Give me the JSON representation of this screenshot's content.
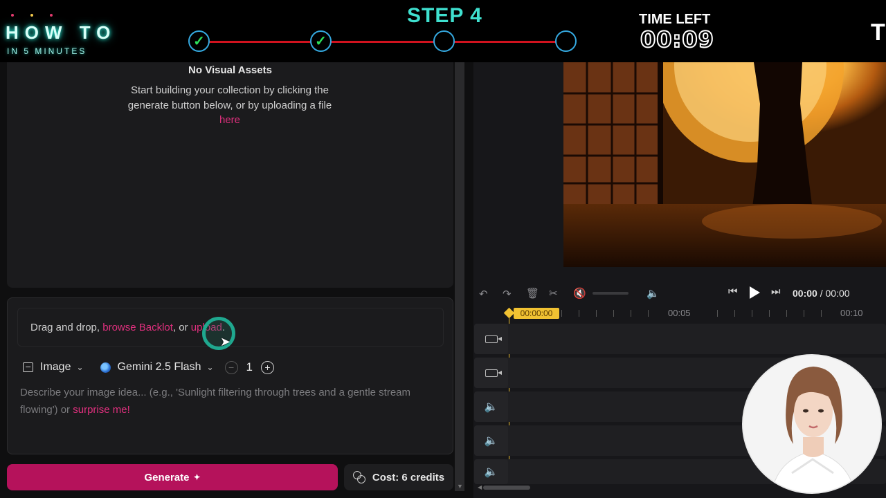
{
  "banner": {
    "howto": "HOW TO",
    "howto_sub": "IN 5 MINUTES",
    "step_title": "STEP 4",
    "time_left_label": "TIME LEFT",
    "time_left_value": "00:09",
    "edge_letter": "T",
    "steps_done": 2,
    "steps_total": 4,
    "colors": {
      "accent": "#3fe0cf",
      "line": "#d0121e",
      "check": "#2ce05a"
    }
  },
  "assets": {
    "empty_title": "No Visual Assets",
    "empty_desc_prefix": "Start building your collection by clicking the generate button below, or by uploading a file ",
    "empty_desc_link": "here"
  },
  "prompt": {
    "drop_prefix": "Drag and drop, ",
    "drop_link1": "browse Backlot",
    "drop_mid": ", or ",
    "drop_link2": "upload",
    "drop_suffix": ".",
    "type_label": "Image",
    "model_label": "Gemini 2.5 Flash",
    "quantity": "1",
    "placeholder": "Describe your image idea... (e.g., 'Sunlight filtering through trees and a gentle stream flowing') or ",
    "surprise_link": "surprise me!"
  },
  "actions": {
    "generate_label": "Generate",
    "cost_label": "Cost: 6 credits"
  },
  "timeline": {
    "current_time": "00:00",
    "total_time": "00:00",
    "playhead_label": "00:00:00",
    "ruler_labels": [
      "00:05",
      "00:10"
    ],
    "tracks": [
      "video",
      "video",
      "audio",
      "audio",
      "audio"
    ]
  },
  "theme": {
    "brand_pink": "#b5125b",
    "link_pink": "#e0307e",
    "playhead": "#f1c232"
  }
}
